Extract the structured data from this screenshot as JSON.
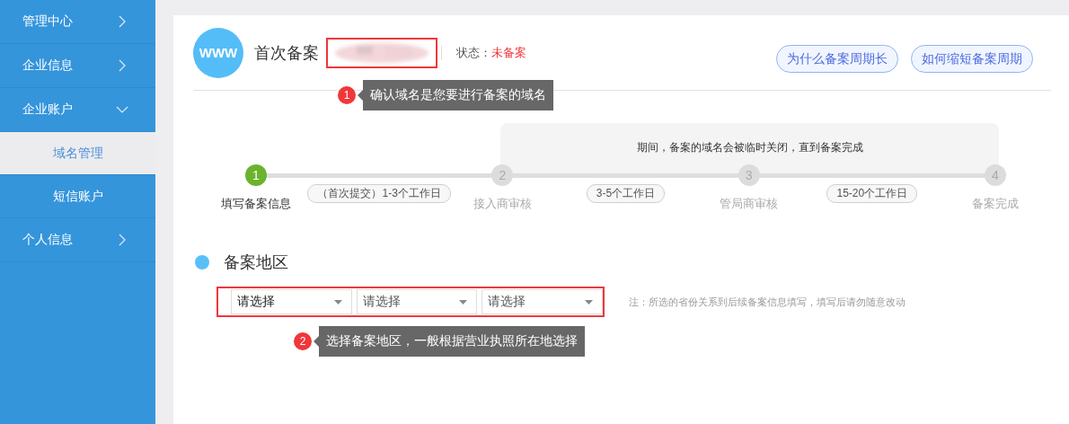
{
  "sidebar": {
    "items": [
      {
        "label": "管理中心",
        "expanded": false
      },
      {
        "label": "企业信息",
        "expanded": false
      },
      {
        "label": "企业账户",
        "expanded": true,
        "children": [
          {
            "label": "域名管理",
            "selected": true
          },
          {
            "label": "短信账户",
            "selected": false
          }
        ]
      },
      {
        "label": "个人信息",
        "expanded": false
      }
    ]
  },
  "header": {
    "logo_text": "WWW",
    "title": "首次备案",
    "status_label": "状态：",
    "status_value": "未备案",
    "callout": {
      "number": "1",
      "text": "确认域名是您要进行备案的域名"
    },
    "buttons": [
      "为什么备案周期长",
      "如何缩短备案周期"
    ]
  },
  "progress": {
    "note": "期间，备案的域名会被临时关闭，直到备案完成",
    "steps": [
      {
        "number": "1",
        "label": "填写备案信息",
        "done": true
      },
      {
        "number": "2",
        "label": "接入商审核",
        "done": false
      },
      {
        "number": "3",
        "label": "管局商审核",
        "done": false
      },
      {
        "number": "4",
        "label": "备案完成",
        "done": false
      }
    ],
    "durations": [
      "（首次提交）1-3个工作日",
      "3-5个工作日",
      "15-20个工作日"
    ]
  },
  "region": {
    "title": "备案地区",
    "selects": [
      {
        "value": "请选择"
      },
      {
        "placeholder": "请选择"
      },
      {
        "placeholder": "请选择"
      }
    ],
    "note": "注：所选的省份关系到后续备案信息填写，填写后请勿随意改动",
    "callout": {
      "number": "2",
      "text": "选择备案地区，一般根据营业执照所在地选择"
    }
  }
}
